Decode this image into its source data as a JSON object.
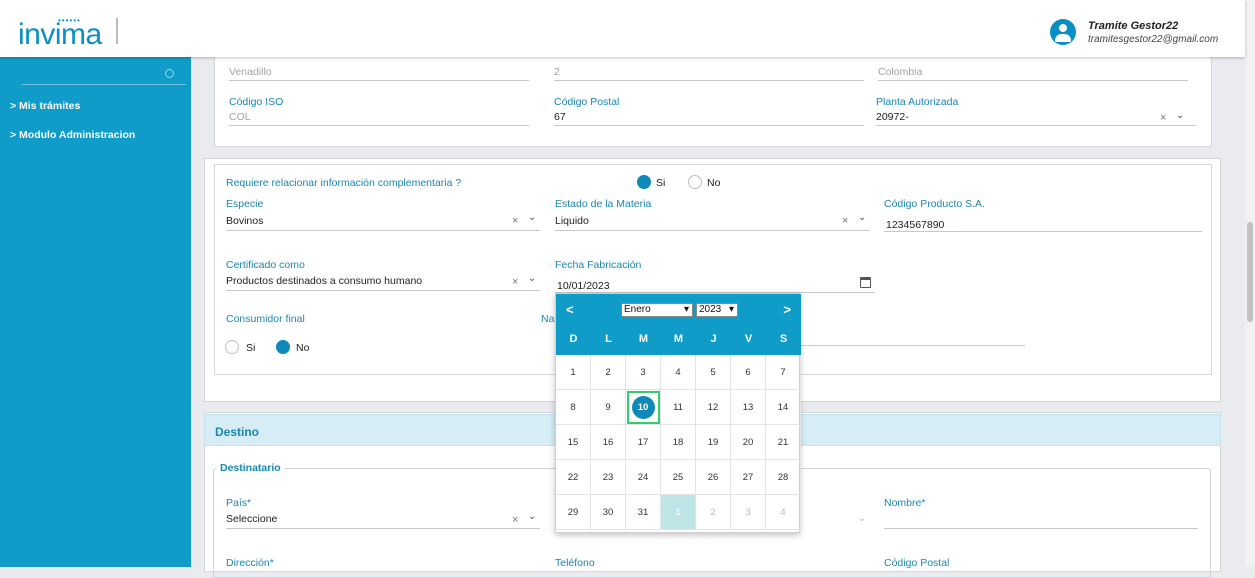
{
  "header": {
    "logo": "invima",
    "user_name": "Tramite Gestor22",
    "user_email": "tramitesgestor22@gmail.com"
  },
  "sidebar": {
    "items": [
      {
        "label": "> Mis trámites"
      },
      {
        "label": "> Modulo Administracion"
      }
    ]
  },
  "top_panel": {
    "row1": [
      "Venadillo",
      "2",
      "Colombia"
    ],
    "codigo_iso_label": "Código ISO",
    "codigo_iso_value": "COL",
    "codigo_postal_label": "Código Postal",
    "codigo_postal_value": "67",
    "planta_label": "Planta Autorizada",
    "planta_value": "20972-"
  },
  "form": {
    "question": "Requiere relacionar información complementaria ?",
    "si": "Si",
    "no": "No",
    "especie_label": "Especie",
    "especie_value": "Bovinos",
    "estado_label": "Estado de la Materia",
    "estado_value": "Liquido",
    "codigo_producto_label": "Código Producto S.A.",
    "codigo_producto_value": "1234567890",
    "certificado_label": "Certificado como",
    "certificado_value": "Productos destinados a consumo humano",
    "fecha_label": "Fecha Fabricación",
    "fecha_value": "10/01/2023",
    "consumidor_label": "Consumidor final",
    "hidden_label_fragment": "Na"
  },
  "calendar": {
    "month": "Enero",
    "year": "2023",
    "weekdays": [
      "D",
      "L",
      "M",
      "M",
      "J",
      "V",
      "S"
    ],
    "weeks": [
      [
        "1",
        "2",
        "3",
        "4",
        "5",
        "6",
        "7"
      ],
      [
        "8",
        "9",
        "10",
        "11",
        "12",
        "13",
        "14"
      ],
      [
        "15",
        "16",
        "17",
        "18",
        "19",
        "20",
        "21"
      ],
      [
        "22",
        "23",
        "24",
        "25",
        "26",
        "27",
        "28"
      ],
      [
        "29",
        "30",
        "31",
        "1",
        "2",
        "3",
        "4"
      ]
    ],
    "selected": "10"
  },
  "destino": {
    "title": "Destino",
    "legend": "Destinatario",
    "pais_label": "País*",
    "pais_value": "Seleccione",
    "nombre_label": "Nombre*",
    "direccion_label": "Dirección*",
    "telefono_label": "Teléfono",
    "codigo_postal_label": "Código Postal"
  }
}
